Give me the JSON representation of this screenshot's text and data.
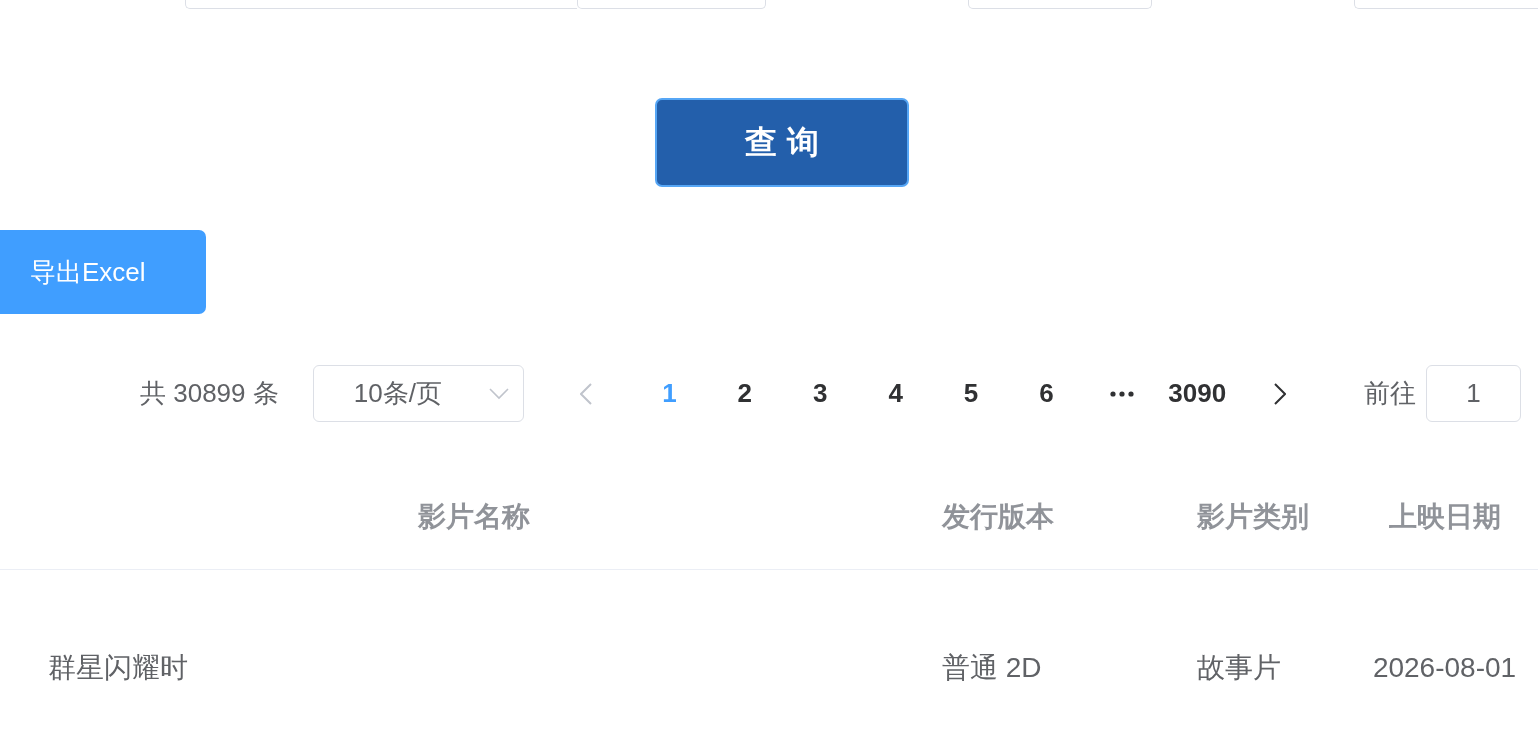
{
  "filter_fields": [
    {
      "kind": "input-select"
    },
    {
      "kind": "input"
    },
    {
      "kind": "input"
    }
  ],
  "query_button": {
    "label": "查询"
  },
  "export_button": {
    "label": "导出Excel"
  },
  "pagination": {
    "total": "共 30899 条",
    "page_size": "10条/页",
    "prev": {
      "disabled": true
    },
    "pages": [
      {
        "kind": "page",
        "label": "1",
        "selected": true
      },
      {
        "kind": "page",
        "label": "2",
        "selected": false
      },
      {
        "kind": "page",
        "label": "3",
        "selected": false
      },
      {
        "kind": "page",
        "label": "4",
        "selected": false
      },
      {
        "kind": "page",
        "label": "5",
        "selected": false
      },
      {
        "kind": "page",
        "label": "6",
        "selected": false
      },
      {
        "kind": "more",
        "selected": false
      },
      {
        "kind": "page",
        "label": "3090",
        "selected": false
      }
    ],
    "next": {
      "disabled": false
    },
    "jump": {
      "label": "前往",
      "value": "1"
    }
  },
  "table": {
    "columns": [
      "影片名称",
      "发行版本",
      "影片类别",
      "上映日期"
    ],
    "rows": [
      [
        "群星闪耀时",
        "普通 2D",
        "故事片",
        "2026-08-01"
      ]
    ]
  }
}
